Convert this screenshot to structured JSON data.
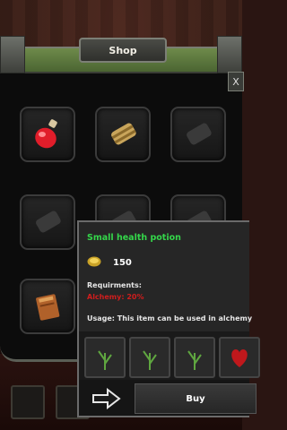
{
  "header": {
    "title": "Shop",
    "close_label": "X"
  },
  "shop_items": [
    {
      "icon": "health-potion-icon"
    },
    {
      "icon": "scroll-icon"
    },
    {
      "icon": "locked-scroll-icon"
    },
    {
      "icon": "locked-scroll-icon"
    },
    {
      "icon": "locked-scroll-icon"
    },
    {
      "icon": "locked-scroll-icon"
    },
    {
      "icon": "book-icon"
    }
  ],
  "tooltip": {
    "name": "Small health potion",
    "price": "150",
    "requirements_label": "Requirments:",
    "requirement_value": "Alchemy: 20%",
    "usage": "Usage: This item can be used in alchemy"
  },
  "ingredients": [
    {
      "icon": "herb-icon"
    },
    {
      "icon": "herb-icon"
    },
    {
      "icon": "herb-icon"
    },
    {
      "icon": "heart-icon"
    }
  ],
  "actions": {
    "buy_label": "Buy"
  },
  "colors": {
    "item_name": "#34d64a",
    "requirement": "#d01d1d",
    "header_green": "#5b7a3c"
  }
}
